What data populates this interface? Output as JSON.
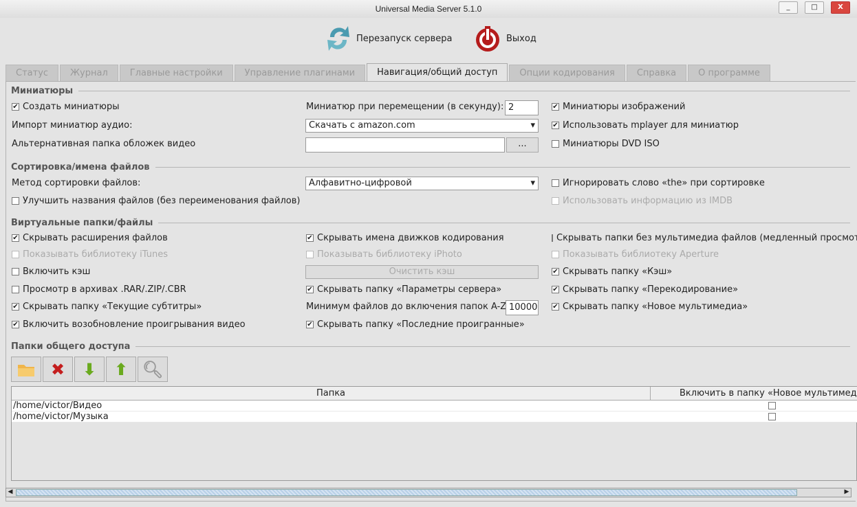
{
  "window": {
    "title": "Universal Media Server 5.1.0",
    "min": "_",
    "max": "□",
    "close": "X"
  },
  "toolbar": {
    "restart": "Перезапуск сервера",
    "exit": "Выход"
  },
  "tabs": [
    "Статус",
    "Журнал",
    "Главные настройки",
    "Управление плагинами",
    "Навигация/общий доступ",
    "Опции кодирования",
    "Справка",
    "О программе"
  ],
  "thumbs": {
    "title": "Миниатюры",
    "create": "Создать миниатюры",
    "seek_label": "Миниатюр при перемещении (в секунду):",
    "seek_value": "2",
    "image_thumbs": "Миниатюры изображений",
    "audio_label": "Импорт миниатюр аудио:",
    "audio_value": "Скачать с amazon.com",
    "mplayer": "Использовать mplayer для миниатюр",
    "alt_folder": "Альтернативная папка обложек видео",
    "alt_value": "",
    "browse": "...",
    "dvd": "Миниатюры DVD ISO"
  },
  "sort": {
    "title": "Сортировка/имена файлов",
    "method_label": "Метод сортировки файлов:",
    "method_value": "Алфавитно-цифровой",
    "ignore_the": "Игнорировать слово «the» при сортировке",
    "improve": "Улучшить названия файлов (без переименования файлов)",
    "imdb": "Использовать информацию из IMDB"
  },
  "virtual": {
    "title": "Виртуальные папки/файлы",
    "hide_ext": "Скрывать расширения файлов",
    "hide_engines": "Скрывать имена движков кодирования",
    "hide_empty": "Скрывать папки без мультимедиа файлов (медленный просмотр)",
    "itunes": "Показывать библиотеку iTunes",
    "iphoto": "Показывать библиотеку iPhoto",
    "aperture": "Показывать библиотеку Aperture",
    "cache": "Включить кэш",
    "clear_cache": "Очистить кэш",
    "hide_cache": "Скрывать папку «Кэш»",
    "archives": "Просмотр в архивах .RAR/.ZIP/.CBR",
    "hide_server": "Скрывать папку «Параметры сервера»",
    "hide_transcode": "Скрывать папку «Перекодирование»",
    "hide_subs": "Скрывать папку «Текущие субтитры»",
    "az_label": "Минимум файлов до включения папок A-Z:",
    "az_value": "10000",
    "hide_new": "Скрывать папку «Новое мультимедиа»",
    "resume": "Включить возобновление проигрывания видео",
    "hide_recent": "Скрывать папку «Последние проигранные»"
  },
  "shared": {
    "title": "Папки общего доступа",
    "col_folder": "Папка",
    "col_new": "Включить в папку «Новое мультимедиа»",
    "rows": [
      "/home/victor/Видео",
      "/home/victor/Музыка"
    ]
  }
}
